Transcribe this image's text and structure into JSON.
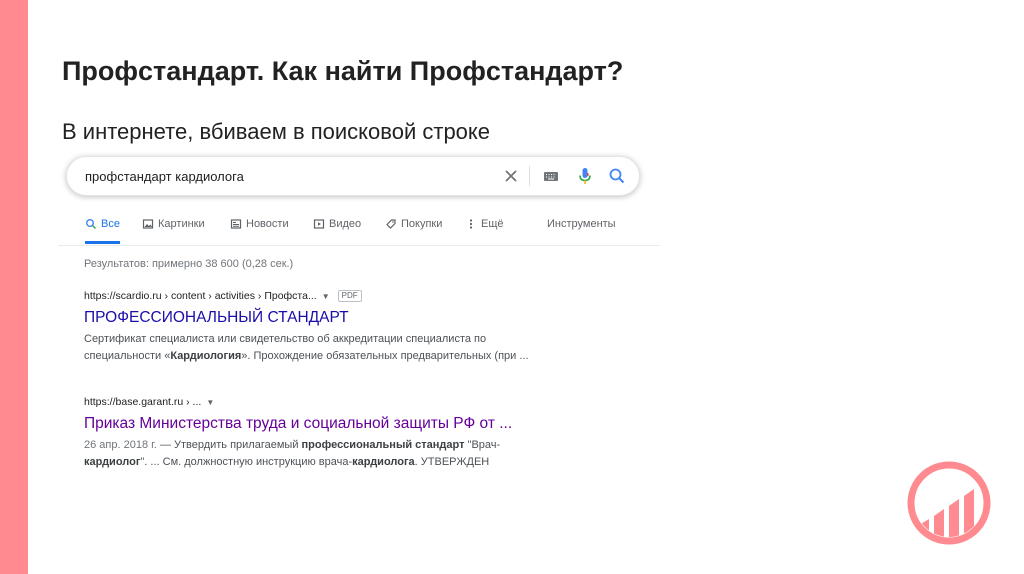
{
  "slide": {
    "title": "Профстандарт. Как найти Профстандарт?",
    "subtitle": "В интернете, вбиваем в поисковой строке"
  },
  "colors": {
    "accent": "#ff8a8f",
    "link": "#1a0dab",
    "visited": "#660099",
    "active_tab": "#1a73e8"
  },
  "search": {
    "query": "профстандарт кардиолога",
    "icons": [
      "clear-icon",
      "keyboard-icon",
      "mic-icon",
      "search-icon"
    ]
  },
  "tabs": [
    {
      "label": "Все",
      "icon": "search-icon",
      "active": true
    },
    {
      "label": "Картинки",
      "icon": "image-icon"
    },
    {
      "label": "Новости",
      "icon": "news-icon"
    },
    {
      "label": "Видео",
      "icon": "video-icon"
    },
    {
      "label": "Покупки",
      "icon": "tag-icon"
    },
    {
      "label": "Ещё",
      "icon": "more-icon"
    },
    {
      "label": "Инструменты"
    }
  ],
  "stats": "Результатов: примерно 38 600 (0,28 сек.)",
  "results": [
    {
      "url": "https://scardio.ru › content › activities › Профста...",
      "badge": "PDF",
      "title": "ПРОФЕССИОНАЛЬНЫЙ СТАНДАРТ",
      "snippet": {
        "line1": "Сертификат специалиста или свидетельство об аккредитации специалиста по",
        "line2_pre": "специальности «",
        "line2_bold": "Кардиология",
        "line2_post": "». Прохождение обязательных предварительных (при ..."
      }
    },
    {
      "url": "https://base.garant.ru › ...",
      "title": "Приказ Министерства труда и социальной защиты РФ от ...",
      "snippet": {
        "date": "26 апр. 2018 г.",
        "line1_pre": " — Утвердить прилагаемый ",
        "line1_bold": "профессиональный стандарт",
        "line1_post": " \"Врач-",
        "line2_bold1": "кардиолог",
        "line2_mid": "\". ... См. должностную инструкцию врача-",
        "line2_bold2": "кардиолога",
        "line2_post": ". УТВЕРЖДЕН"
      }
    }
  ],
  "logo": {
    "icon": "bar-chart-logo-icon"
  }
}
